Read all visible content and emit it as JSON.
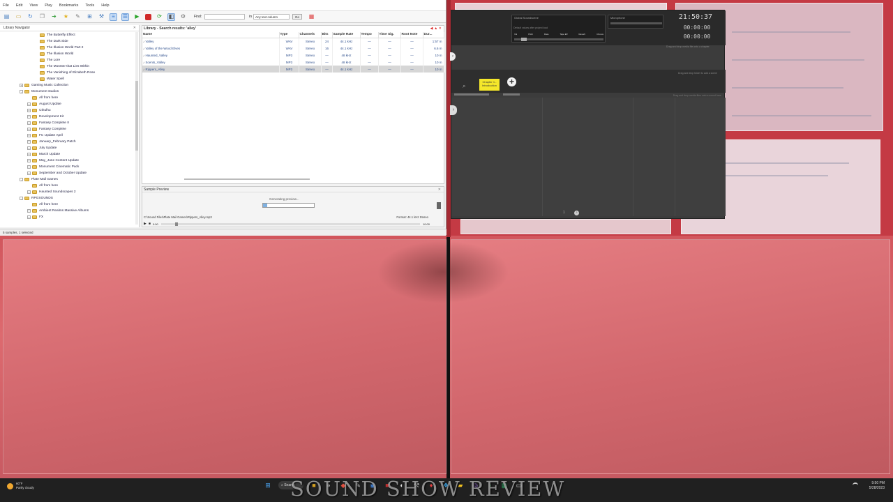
{
  "library": {
    "menu": [
      "File",
      "Edit",
      "View",
      "Play",
      "Bookmarks",
      "Tools",
      "Help"
    ],
    "find_label": "Find:",
    "in_label": "in",
    "column_select": "Any text column",
    "go_label": "Go",
    "navigator_title": "Library Navigator",
    "tree": [
      {
        "label": "The Butterfly Effect",
        "indent": 3,
        "expander": ""
      },
      {
        "label": "The Dark Side",
        "indent": 3,
        "expander": ""
      },
      {
        "label": "The Illusion World Part 2",
        "indent": 3,
        "expander": ""
      },
      {
        "label": "The Illusion World",
        "indent": 3,
        "expander": ""
      },
      {
        "label": "The Lore",
        "indent": 3,
        "expander": ""
      },
      {
        "label": "The Monster that Lies Within",
        "indent": 3,
        "expander": ""
      },
      {
        "label": "The Vanishing of Elizabeth Rose",
        "indent": 3,
        "expander": ""
      },
      {
        "label": "Water Spell",
        "indent": 3,
        "expander": ""
      },
      {
        "label": "Gaming Music Collection",
        "indent": 1,
        "expander": "+"
      },
      {
        "label": "Monument studios",
        "indent": 1,
        "expander": "-"
      },
      {
        "label": "All from here",
        "indent": 2,
        "expander": ""
      },
      {
        "label": "August Update",
        "indent": 2,
        "expander": "+"
      },
      {
        "label": "Cthulhu",
        "indent": 2,
        "expander": "+"
      },
      {
        "label": "Development Kit",
        "indent": 2,
        "expander": "+"
      },
      {
        "label": "Fantasy Complete II",
        "indent": 2,
        "expander": "+"
      },
      {
        "label": "Fantasy Complete",
        "indent": 2,
        "expander": "+"
      },
      {
        "label": "FC Update April",
        "indent": 2,
        "expander": "+"
      },
      {
        "label": "January_February Patch",
        "indent": 2,
        "expander": "+"
      },
      {
        "label": "July Update",
        "indent": 2,
        "expander": "+"
      },
      {
        "label": "March Update",
        "indent": 2,
        "expander": "+"
      },
      {
        "label": "May_June Content Update",
        "indent": 2,
        "expander": "+"
      },
      {
        "label": "Monument Cinematic Pack",
        "indent": 2,
        "expander": "+"
      },
      {
        "label": "September and October Update",
        "indent": 2,
        "expander": "+"
      },
      {
        "label": "Plate Mail Games",
        "indent": 1,
        "expander": "-"
      },
      {
        "label": "All from here",
        "indent": 2,
        "expander": ""
      },
      {
        "label": "Haunted Soundscapes 2",
        "indent": 2,
        "expander": "+"
      },
      {
        "label": "RPGSOUNDS",
        "indent": 1,
        "expander": "-"
      },
      {
        "label": "All from here",
        "indent": 2,
        "expander": ""
      },
      {
        "label": "Ambient Realms Massive Albums",
        "indent": 2,
        "expander": "+"
      },
      {
        "label": "FX",
        "indent": 2,
        "expander": "+"
      }
    ],
    "results_title": "Library - Search results: 'alley'",
    "columns": [
      "Name",
      "Type",
      "Channels",
      "Bits",
      "Sample Rate",
      "Tempo",
      "Time Sig.",
      "Root Note",
      "Dur..."
    ],
    "rows": [
      {
        "name": "Valley",
        "type": "WAV",
        "channels": "Stereo",
        "bits": "24",
        "rate": "44.1 kHz",
        "tempo": "—",
        "timesig": "—",
        "root": "—",
        "dur": "1:57 m",
        "selected": false
      },
      {
        "name": "Valley of the Wood Elves",
        "type": "WAV",
        "channels": "Stereo",
        "bits": "16",
        "rate": "44.1 kHz",
        "tempo": "—",
        "timesig": "—",
        "root": "—",
        "dur": "6.6 m",
        "selected": false
      },
      {
        "name": "Haunted_Valley",
        "type": "MP3",
        "channels": "Stereo",
        "bits": "—",
        "rate": "48 kHz",
        "tempo": "—",
        "timesig": "—",
        "root": "—",
        "dur": "10 m",
        "selected": false
      },
      {
        "name": "Scents_Valley",
        "type": "MP3",
        "channels": "Stereo",
        "bits": "—",
        "rate": "48 kHz",
        "tempo": "—",
        "timesig": "—",
        "root": "—",
        "dur": "10 m",
        "selected": false
      },
      {
        "name": "Rippers_Alley",
        "type": "MP3",
        "channels": "Stereo",
        "bits": "—",
        "rate": "44.1 kHz",
        "tempo": "—",
        "timesig": "—",
        "root": "—",
        "dur": "10 m",
        "selected": true
      }
    ],
    "preview_title": "Sample Preview",
    "generating": "Generating preview...",
    "generating_progress": 0.08,
    "file_path": "C:\\Sound Files\\Plate Mail Games\\Rippers_Alley.mp3",
    "format": "Format: 44.1 kHz Stereo",
    "time_start": "0:00",
    "time_end": "10:00",
    "status": "5 samples, 1 selected"
  },
  "soundshow": {
    "mixer_label": "Global Soundscene",
    "mixer_hint": "Default values after project load",
    "mixer_cols": [
      "Vol",
      "Pitch",
      "Rate",
      "Tape Eff",
      "Reverb",
      "Chorus"
    ],
    "mic_label": "Microphone",
    "clock": "21:50:37",
    "counter1": "00:00:00",
    "counter2": "00:00:00",
    "drag_hint_top": "Drag and drop media file onto a chapter",
    "chapter_label": "Chapter 1 - Introduction",
    "drag_hint_mid": "Drag and drop folder to add a scene",
    "drag_hint_low": "Drag and drop media files onto a sound here",
    "page": "1"
  },
  "taskbar": {
    "weather_temp": "60°F",
    "weather_desc": "Partly cloudy",
    "search_label": "Search",
    "overlay_title": "SOUND SHOW REVIEW",
    "time": "9:50 PM",
    "date": "5/28/2023"
  },
  "colors": {
    "desktop_red": "#c7444c",
    "chapter_yellow": "#f5e72a",
    "play_green": "#2aa52a",
    "stop_red": "#d02b2b"
  }
}
